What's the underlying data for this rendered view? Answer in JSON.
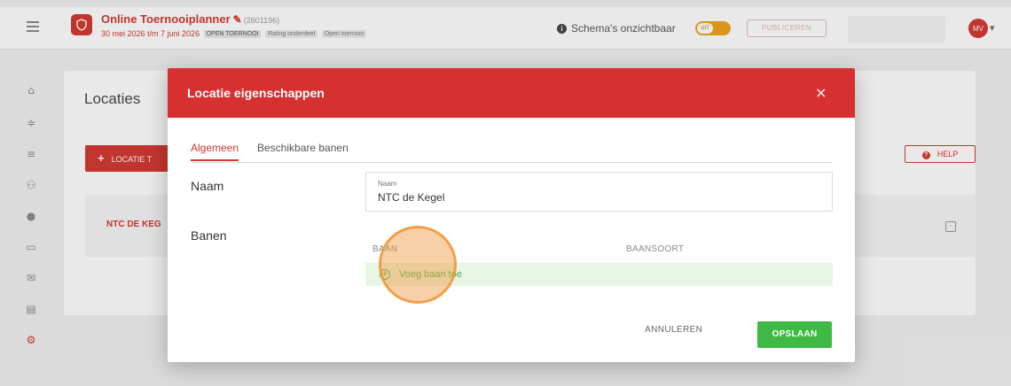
{
  "app": {
    "tournament_title": "Online Toernooiplanner",
    "tournament_id": "(2601196)",
    "dates": "30 mei 2026 t/m 7 juni 2026",
    "tags": [
      "OPEN TOERNOOI",
      "Rating onderdeel",
      "Open toernooi"
    ],
    "visibility_label": "Schema's onzichtbaar",
    "toggle_text": "UIT",
    "publish_label": "PUBLICEREN",
    "avatar_initials": "MV"
  },
  "page": {
    "title": "Locaties",
    "add_location_label": "LOCATIE T",
    "help_label": "HELP",
    "location_name": "NTC DE KEG"
  },
  "modal": {
    "title": "Locatie eigenschappen",
    "close_symbol": "×",
    "tabs": [
      {
        "label": "Algemeen",
        "active": true
      },
      {
        "label": "Beschikbare banen",
        "active": false
      }
    ],
    "name_section_label": "Naam",
    "name_field_label": "Naam",
    "name_field_value": "NTC de Kegel",
    "courts_section_label": "Banen",
    "courts_columns": [
      "BAAN",
      "BAANSOORT"
    ],
    "add_court_label": "Voeg baan toe",
    "cancel_label": "ANNULEREN",
    "save_label": "OPSLAAN"
  },
  "colors": {
    "brand_red": "#d4372f",
    "success_green": "#3db944",
    "toggle_orange": "#f0a21a"
  }
}
